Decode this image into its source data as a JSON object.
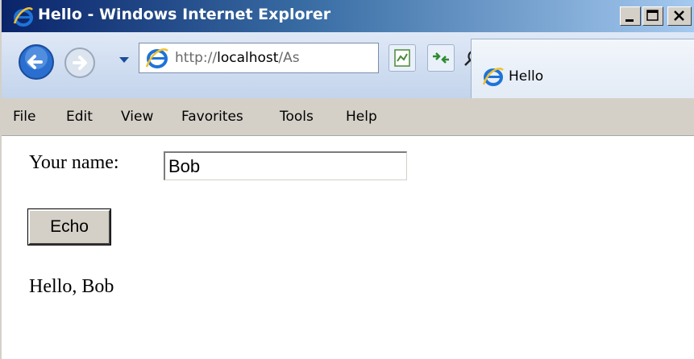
{
  "window": {
    "title": "Hello - Windows Internet Explorer",
    "controls": [
      "minimize",
      "maximize",
      "close"
    ]
  },
  "address_bar": {
    "url_prefix": "http://",
    "url_host": "localhost",
    "url_rest": "/As",
    "tab_title": "Hello"
  },
  "menu": {
    "items": [
      "File",
      "Edit",
      "View",
      "Favorites",
      "Tools",
      "Help"
    ]
  },
  "form": {
    "name_label": "Your name:",
    "name_value": "Bob",
    "echo_label": "Echo",
    "result": "Hello, Bob"
  },
  "colors": {
    "titlebar_start": "#0a246a",
    "titlebar_end": "#a6caf0",
    "chrome": "#d4d0c8"
  }
}
